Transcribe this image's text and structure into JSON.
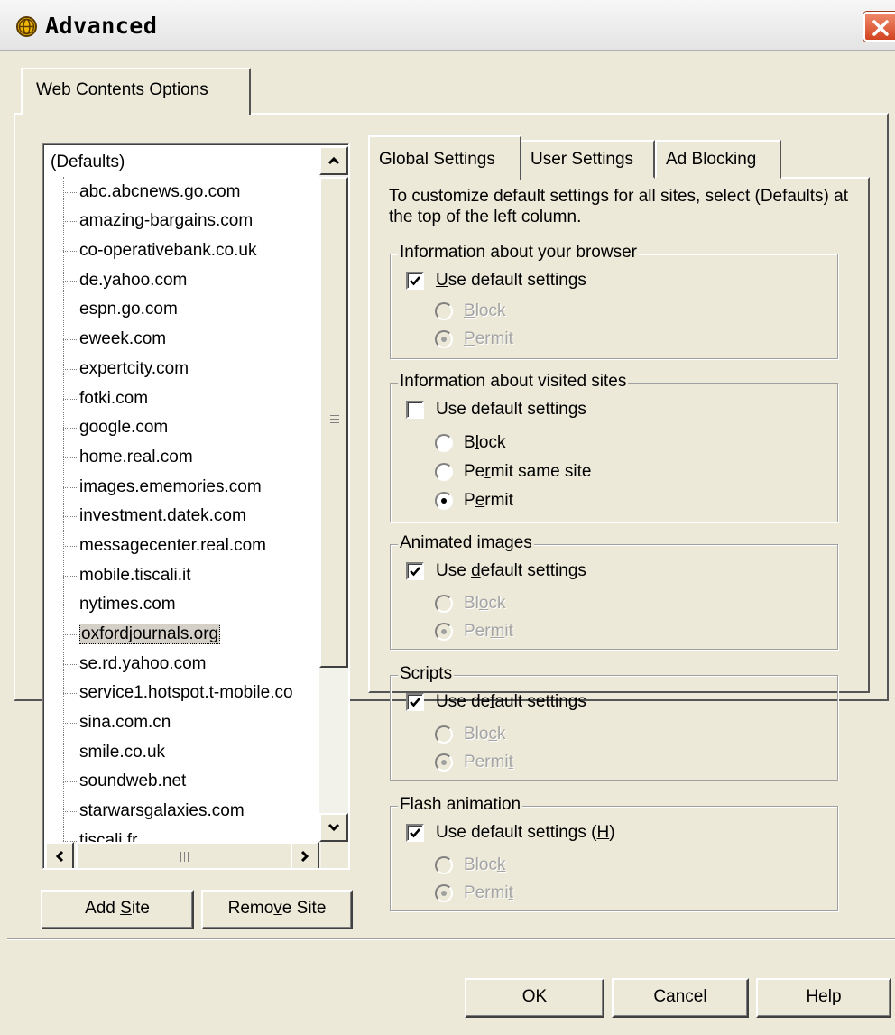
{
  "window": {
    "title": "Advanced",
    "close_icon": "close-icon"
  },
  "outer_tab": {
    "label": "Web Contents Options"
  },
  "site_tree": {
    "root": "(Defaults)",
    "items": [
      "abc.abcnews.go.com",
      "amazing-bargains.com",
      "co-operativebank.co.uk",
      "de.yahoo.com",
      "espn.go.com",
      "eweek.com",
      "expertcity.com",
      "fotki.com",
      "google.com",
      "home.real.com",
      "images.ememories.com",
      "investment.datek.com",
      "messagecenter.real.com",
      "mobile.tiscali.it",
      "nytimes.com",
      "oxfordjournals.org",
      "se.rd.yahoo.com",
      "service1.hotspot.t-mobile.co",
      "sina.com.cn",
      "smile.co.uk",
      "soundweb.net",
      "starwarsgalaxies.com",
      "tiscali.fr"
    ],
    "selected": "oxfordjournals.org"
  },
  "buttons": {
    "add_site": {
      "pre": "Add ",
      "key": "S",
      "post": "ite"
    },
    "remove_site": {
      "pre": "Remo",
      "key": "v",
      "post": "e Site"
    },
    "ok": "OK",
    "cancel": "Cancel",
    "help": "Help"
  },
  "tabs": {
    "global": "Global Settings",
    "user": "User Settings",
    "ad": "Ad Blocking"
  },
  "info_text": "To customize default settings for all sites, select (Defaults) at the top of the left column.",
  "groups": {
    "browser": {
      "title": "Information about your browser",
      "use_default": {
        "pre": "",
        "key": "U",
        "post": "se default settings",
        "checked": true
      },
      "block": {
        "pre": "",
        "key": "B",
        "post": "lock"
      },
      "permit": {
        "pre": "",
        "key": "P",
        "post": "ermit",
        "selected": true
      }
    },
    "visited": {
      "title": "Information about visited sites",
      "use_default": {
        "pre": "Use default settin",
        "key": "g",
        "post": "s",
        "checked": false
      },
      "block": {
        "pre": "B",
        "key": "l",
        "post": "ock"
      },
      "permit_same": {
        "pre": "Pe",
        "key": "r",
        "post": "mit same site"
      },
      "permit": {
        "pre": "P",
        "key": "e",
        "post": "rmit",
        "selected": true
      }
    },
    "animated": {
      "title": "Animated images",
      "use_default": {
        "pre": "Use ",
        "key": "d",
        "post": "efault settings",
        "checked": true
      },
      "block": {
        "pre": "Bl",
        "key": "o",
        "post": "ck"
      },
      "permit": {
        "pre": "Per",
        "key": "m",
        "post": "it",
        "selected": true
      }
    },
    "scripts": {
      "title": "Scripts",
      "use_default": {
        "pre": "Use de",
        "key": "f",
        "post": "ault settings",
        "checked": true
      },
      "block": {
        "pre": "Blo",
        "key": "c",
        "post": "k"
      },
      "permit": {
        "pre": "Permi",
        "key": "t",
        "post": "",
        "selected": true
      }
    },
    "flash": {
      "title": "Flash animation",
      "use_default": {
        "pre": "Use default settings (",
        "key": "H",
        "post": ")",
        "checked": true
      },
      "block": {
        "pre": "Bloc",
        "key": "k",
        "post": ""
      },
      "permit": {
        "pre": "Permi",
        "key": "t",
        "post": "",
        "selected": true
      }
    }
  }
}
